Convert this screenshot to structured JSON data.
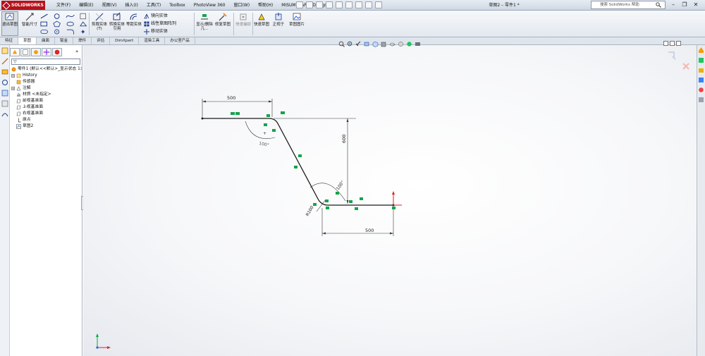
{
  "app": {
    "brand": "SOLIDWORKS",
    "doc_title": "草图2 – 零件1 *"
  },
  "menu": [
    {
      "label": "文件(F)"
    },
    {
      "label": "编辑(E)"
    },
    {
      "label": "视图(V)"
    },
    {
      "label": "插入(I)"
    },
    {
      "label": "工具(T)"
    },
    {
      "label": "Toolbox"
    },
    {
      "label": "PhotoView 360"
    },
    {
      "label": "窗口(W)"
    },
    {
      "label": "帮助(H)"
    },
    {
      "label": "MISUMI RAPID Design"
    }
  ],
  "search": {
    "placeholder": "搜索 SolidWorks 帮助"
  },
  "window_controls": {
    "minimize": "–",
    "restore": "❐",
    "close": "✕"
  },
  "ribbon": {
    "exit_sketch": "退出草图",
    "smart_dim": "智能尺寸",
    "trim": "剪裁实体(T)",
    "convert": "转换实体引用",
    "offset": "等距实体",
    "mirror": "镜向实体",
    "linear_pattern": "线性草图阵列",
    "move": "移动实体",
    "display_delete": "显示/删除几...",
    "repair": "修复草图",
    "quick_snap": "快速捕捉",
    "rapid_sketch": "快速草图",
    "instant2d": "正视于",
    "sketch_pic": "草图图片"
  },
  "cm_tabs": [
    {
      "label": "特征"
    },
    {
      "label": "草图",
      "active": true
    },
    {
      "label": "曲面"
    },
    {
      "label": "钣金"
    },
    {
      "label": "焊件"
    },
    {
      "label": "评估"
    },
    {
      "label": "DimXpert"
    },
    {
      "label": "渲染工具"
    },
    {
      "label": "办公室产品"
    }
  ],
  "feature_tree": {
    "root": "零件1 (默认<<默认>_显示状态 1>)",
    "items": [
      {
        "label": "History",
        "expandable": true
      },
      {
        "label": "传感器",
        "expandable": false
      },
      {
        "label": "注解",
        "expandable": true
      },
      {
        "label": "材质 <未指定>",
        "expandable": false
      },
      {
        "label": "前视基准面",
        "expandable": false
      },
      {
        "label": "上视基准面",
        "expandable": false
      },
      {
        "label": "右视基准面",
        "expandable": false
      },
      {
        "label": "原点",
        "expandable": false
      },
      {
        "label": "草图2",
        "expandable": false
      }
    ]
  },
  "sketch": {
    "dim_top": "500",
    "dim_bottom": "500",
    "dim_vertical": "600",
    "angle_left": "100°",
    "angle_right": "100°",
    "radius": "R100"
  },
  "colors": {
    "sketch_line": "#1b1b1b",
    "dimension": "#3a3a3a",
    "relation": "#16a34a",
    "origin_red": "#e11d1d"
  }
}
